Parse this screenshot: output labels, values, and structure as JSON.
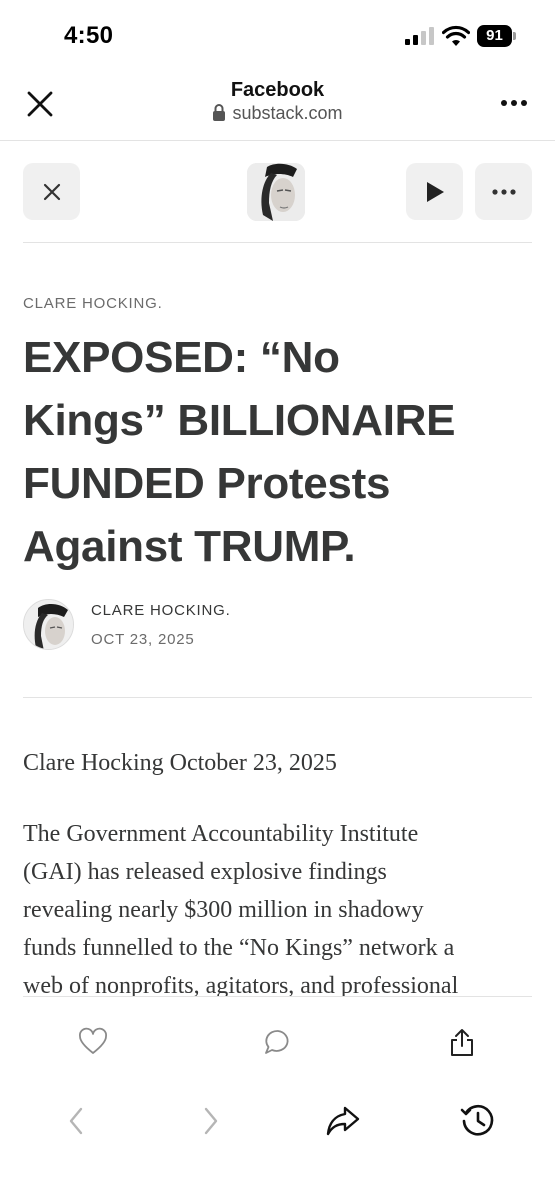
{
  "status_bar": {
    "time": "4:50",
    "battery": "91"
  },
  "browser": {
    "title": "Facebook",
    "url": "substack.com"
  },
  "article": {
    "kicker": "CLARE HOCKING.",
    "headline_lines": [
      "EXPOSED: “No",
      "Kings” BILLIONAIRE",
      "FUNDED Protests",
      "Against TRUMP."
    ],
    "byline": {
      "name": "CLARE HOCKING.",
      "date": "OCT 23, 2025"
    },
    "dateline": "Clare Hocking October 23, 2025",
    "body_lines": [
      "The Government Accountability Institute",
      "(GAI) has released explosive findings",
      "revealing nearly $300 million in shadowy",
      "funds funnelled to the “No Kings” network a",
      "web of nonprofits, agitators, and professional"
    ]
  },
  "icons": {
    "browser_close": "close-icon",
    "lock": "lock-icon",
    "browser_more": "more-icon",
    "toolbar_close": "close-icon",
    "toolbar_play": "play-icon",
    "toolbar_more": "more-icon",
    "like": "heart-icon",
    "comment": "comment-icon",
    "share": "share-icon",
    "back": "chevron-left-icon",
    "forward": "chevron-right-icon",
    "forward_share": "forward-share-icon",
    "history": "history-icon"
  }
}
